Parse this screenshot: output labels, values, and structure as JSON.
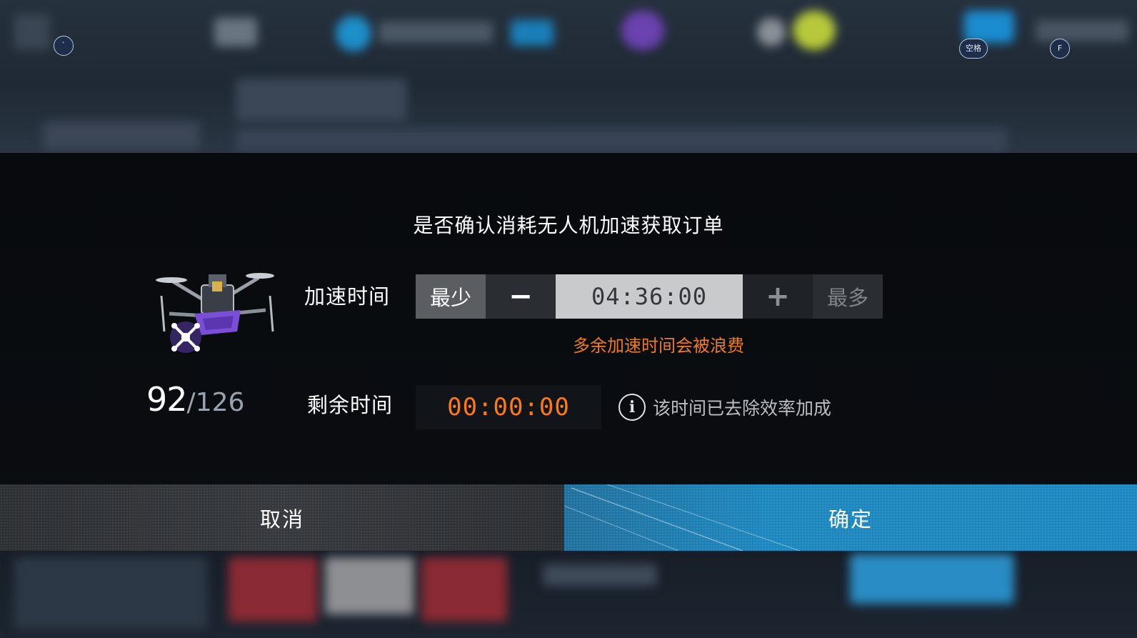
{
  "dialog": {
    "title": "是否确认消耗无人机加速获取订单",
    "drone_count": {
      "current": "92",
      "separator": "/",
      "max": "126"
    },
    "accel_row": {
      "label": "加速时间",
      "min_label": "最少",
      "decrease_label": "−",
      "value": "04:36:00",
      "increase_label": "+",
      "max_label": "最多",
      "warning": "多余加速时间会被浪费"
    },
    "remain_row": {
      "label": "剩余时间",
      "value": "00:00:00",
      "info_icon": "i",
      "info_text": "该时间已去除效率加成"
    },
    "cancel_label": "取消",
    "confirm_label": "确定"
  },
  "hotkeys": {
    "back": "`",
    "space": "空格",
    "f_key": "F"
  },
  "colors": {
    "accent_blue": "#1a86bf",
    "warning_orange": "#f07a1e",
    "timer_orange": "#ff7a12",
    "drone_purple": "#7a4fd6"
  }
}
